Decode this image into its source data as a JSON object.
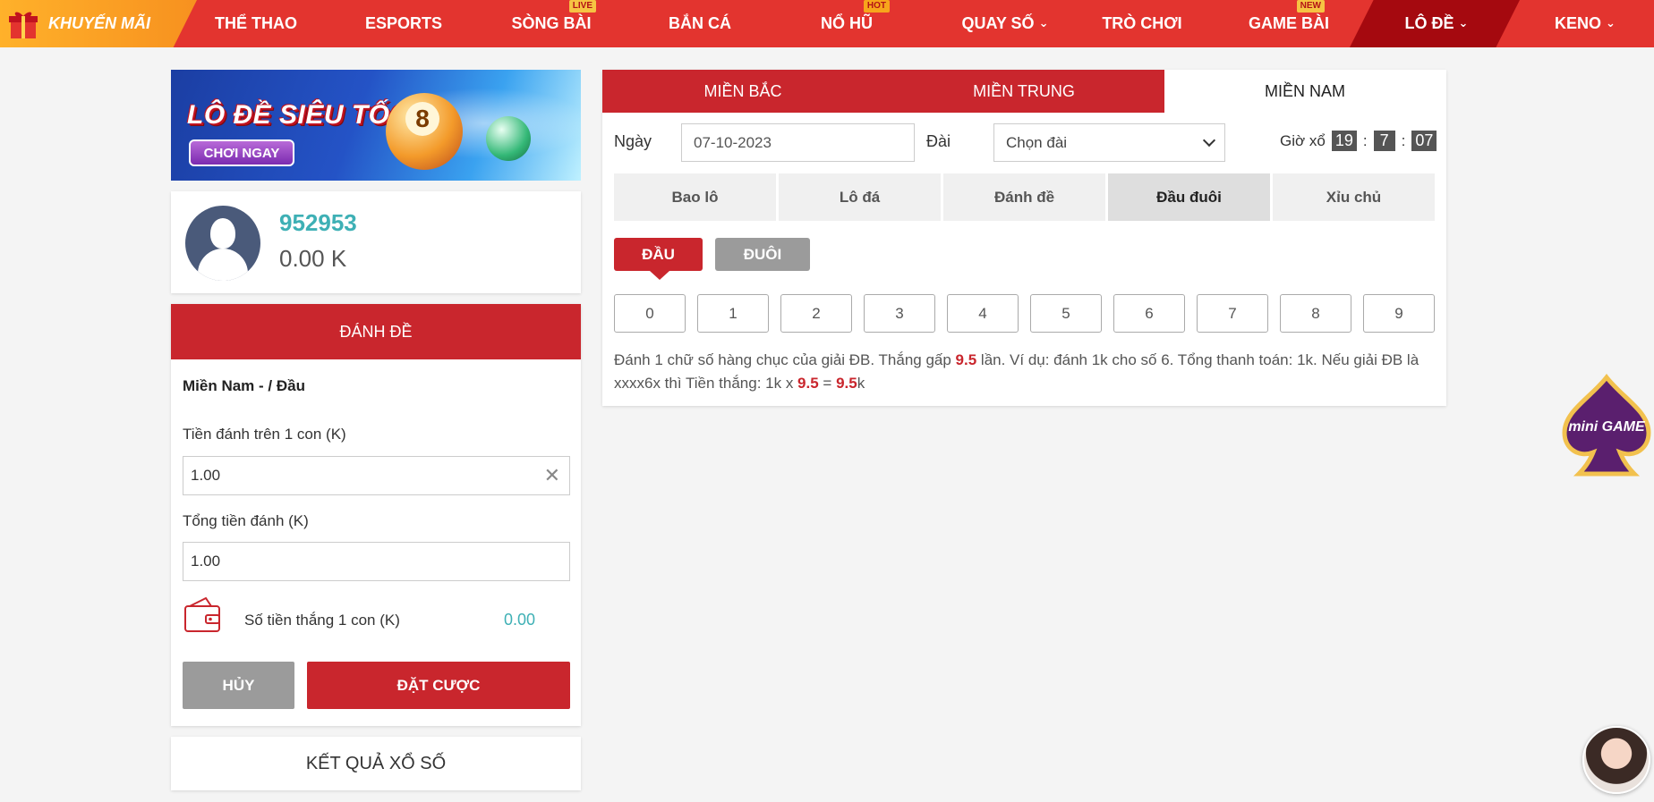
{
  "nav": {
    "promo_label": "KHUYẾN MÃI",
    "items": [
      {
        "label": "THỂ THAO"
      },
      {
        "label": "ESPORTS"
      },
      {
        "label": "SÒNG BÀI",
        "badge": "LIVE"
      },
      {
        "label": "BẮN CÁ"
      },
      {
        "label": "NỔ HŨ",
        "badge": "HOT"
      },
      {
        "label": "QUAY SỐ"
      },
      {
        "label": "TRÒ CHƠI"
      },
      {
        "label": "GAME BÀI",
        "badge": "NEW"
      },
      {
        "label": "LÔ ĐỀ"
      },
      {
        "label": "KENO"
      }
    ],
    "active_color": "#a5090f",
    "bar_color": "#e3342f"
  },
  "banner": {
    "title": "LÔ ĐỀ SIÊU TỐC",
    "cta": "CHƠI NGAY",
    "ball_number": "8"
  },
  "user": {
    "id": "952953",
    "balance": "0.00 K"
  },
  "bet_panel": {
    "header": "ĐÁNH ĐỀ",
    "subtitle": "Miền Nam - / Đầu",
    "amount_label": "Tiền đánh trên 1 con (K)",
    "amount_value": "1.00",
    "total_label": "Tổng tiền đánh (K)",
    "total_value": "1.00",
    "win_label": "Số tiền thắng 1 con (K)",
    "win_value": "0.00",
    "cancel_label": "HỦY",
    "place_label": "ĐẶT CƯỢC"
  },
  "results_label": "KẾT QUẢ XỔ SỐ",
  "main": {
    "regions": [
      {
        "label": "MIỀN BẮC",
        "active": false
      },
      {
        "label": "MIỀN TRUNG",
        "active": false
      },
      {
        "label": "MIỀN NAM",
        "active": true
      }
    ],
    "date_label": "Ngày",
    "date_value": "07-10-2023",
    "station_label": "Đài",
    "station_value": "Chọn đài",
    "draw_time_label": "Giờ xổ",
    "draw_time": {
      "h": "19",
      "m": "7",
      "s": "07"
    },
    "bet_types": [
      {
        "label": "Bao lô",
        "active": false
      },
      {
        "label": "Lô đá",
        "active": false
      },
      {
        "label": "Đánh đề",
        "active": false
      },
      {
        "label": "Đầu đuôi",
        "active": true
      },
      {
        "label": "Xỉu chủ",
        "active": false
      }
    ],
    "head_label": "ĐẦU",
    "tail_label": "ĐUÔI",
    "digits": [
      "0",
      "1",
      "2",
      "3",
      "4",
      "5",
      "6",
      "7",
      "8",
      "9"
    ],
    "desc": {
      "p1": "Đánh 1 chữ số hàng chục của giải ĐB. Thắng gấp ",
      "h1": "9.5",
      "p2": " lần. Ví dụ: đánh 1k cho số 6. Tổng thanh toán: 1k. Nếu giải ĐB là xxxx6x thì Tiền thắng: 1k x ",
      "h2": "9.5",
      "p3": " = ",
      "h3": "9.5",
      "p4": "k"
    }
  },
  "floating": {
    "mini_game_label": "mini GAME"
  },
  "colors": {
    "brand_red": "#c9262d",
    "accent_teal": "#3eb0b5",
    "grey_button": "#9b9b9b"
  }
}
